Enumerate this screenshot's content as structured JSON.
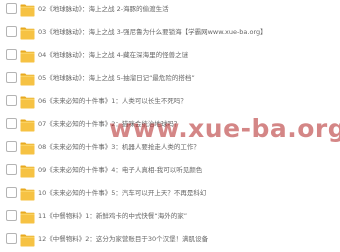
{
  "watermark": "www.xue-ba.org",
  "colors": {
    "folder_fill": "#f6c243",
    "folder_tab": "#e8a91f",
    "checkbox_border": "#b4b4b4",
    "text": "#666666",
    "watermark": "#b02222"
  },
  "items": [
    {
      "label": "02《地球脉动》：海上之战 2-海豚的偷渡生活"
    },
    {
      "label": "03《地球脉动》：海上之战 3-强尼鲁为什么要锁海【学霸网www.xue-ba.org】"
    },
    {
      "label": "04《地球脉动》：海上之战 4-藏在深海里的怪兽之谜"
    },
    {
      "label": "05《地球脉动》：海上之战 5-抽溜日记“最危险的搭档”"
    },
    {
      "label": "06《未来必知的十件事》1：人类可以长生不死吗？"
    },
    {
      "label": "07《未来必知的十件事》2：猫咪会统治地球吗？"
    },
    {
      "label": "08《未来必知的十件事》3：机器人要抢走人类的工作？"
    },
    {
      "label": "09《未来必知的十件事》4：电子人真相-我可以听见颜色"
    },
    {
      "label": "10《未来必知的十件事》5：汽车可以开上天？不再是科幻"
    },
    {
      "label": "11《中餐物料》1：新鲜鸡卡的中式快餐“海外的家”"
    },
    {
      "label": "12《中餐物料》2：这分为家营账目于30个汉堡！满肌设备"
    }
  ]
}
